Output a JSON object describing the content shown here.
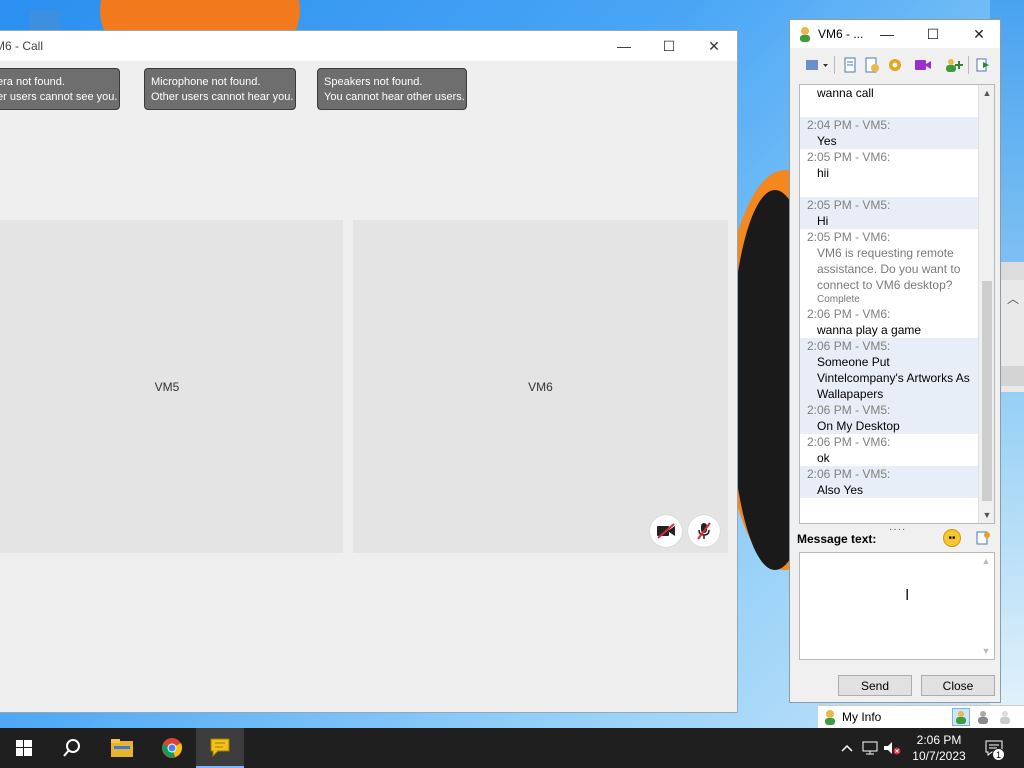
{
  "call_window": {
    "title": "M6 - Call",
    "tooltips": [
      {
        "line1": "era not found.",
        "line2": "er users cannot see you."
      },
      {
        "line1": "Microphone not found.",
        "line2": "Other users cannot hear you."
      },
      {
        "line1": "Speakers not found.",
        "line2": "You cannot hear other users."
      }
    ],
    "tiles": [
      {
        "label": "VM5"
      },
      {
        "label": "VM6"
      }
    ]
  },
  "chat_window": {
    "title": "VM6 - ...",
    "messages": [
      {
        "time": "",
        "text": "wanna call",
        "alt": false
      },
      {
        "time": "2:04 PM - VM5:",
        "text": "Yes",
        "alt": true
      },
      {
        "time": "2:05 PM - VM6:",
        "text": "hii",
        "alt": false
      },
      {
        "time": "2:05 PM - VM5:",
        "text": "Hi",
        "alt": true
      },
      {
        "time": "2:05 PM - VM6:",
        "text": "VM6 is requesting remote assistance. Do you want to connect to VM6 desktop?",
        "status": "Complete",
        "alt": false
      },
      {
        "time": "2:06 PM - VM6:",
        "text": "wanna play a game",
        "alt": false
      },
      {
        "time": "2:06 PM - VM5:",
        "text": "Someone Put Vintelcompany's Artworks As Wallapapers",
        "alt": true
      },
      {
        "time": "2:06 PM - VM5:",
        "text": "On My Desktop",
        "alt": true
      },
      {
        "time": "2:06 PM - VM6:",
        "text": "ok",
        "alt": false
      },
      {
        "time": "2:06 PM - VM5:",
        "text": "Also Yes",
        "alt": true
      }
    ],
    "message_label": "Message text:",
    "message_value": "",
    "send_label": "Send",
    "close_label": "Close"
  },
  "myinfo": {
    "label": "My Info"
  },
  "taskbar": {
    "time": "2:06 PM",
    "date": "10/7/2023",
    "notification_count": "1"
  },
  "colors": {
    "taskbar": "#1f1f1f",
    "tooltip": "#6e6e6e",
    "message_alt": "#e8eef7",
    "timestamp": "#808080"
  },
  "icons": [
    "windows-start-icon",
    "search-icon",
    "file-explorer-icon",
    "chrome-icon",
    "chat-app-icon",
    "chevron-up-icon",
    "network-icon",
    "volume-muted-icon",
    "notification-icon",
    "camera-off-icon",
    "microphone-off-icon",
    "smiley-icon"
  ]
}
